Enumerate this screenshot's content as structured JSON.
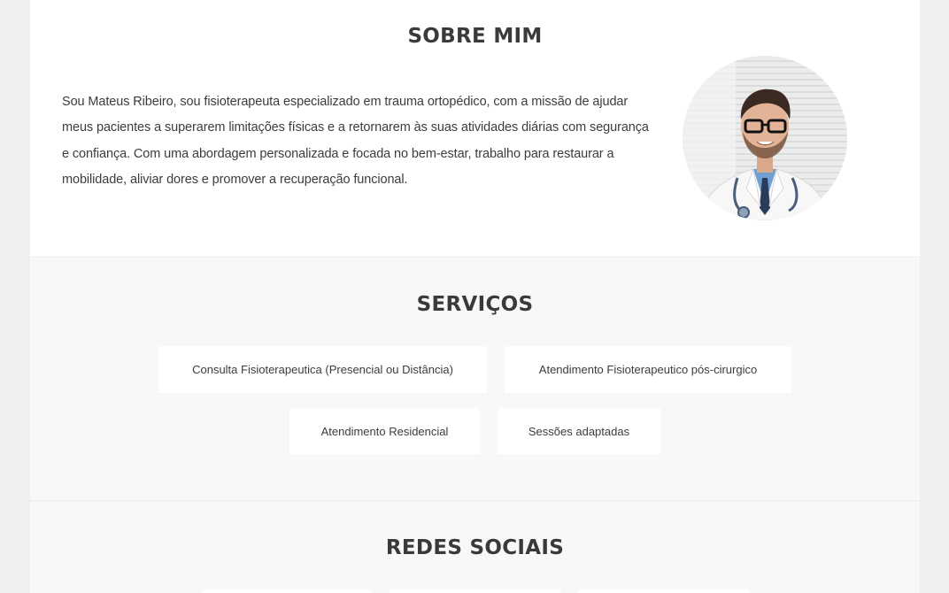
{
  "about": {
    "title": "SOBRE MIM",
    "text": "Sou Mateus Ribeiro, sou fisioterapeuta especializado em trauma ortopédico, com a missão de ajudar meus pacientes a superarem limitações físicas e a retornarem às suas atividades diárias com segurança e confiança. Com uma abordagem personalizada e focada no bem-estar, trabalho para restaurar a mobilidade, aliviar dores e promover a recuperação funcional."
  },
  "services": {
    "title": "SERVIÇOS",
    "items": [
      "Consulta Fisioterapeutica (Presencial ou Distância)",
      "Atendimento Fisioterapeutico pós-cirurgico",
      "Atendimento Residencial",
      "Sessões adaptadas"
    ]
  },
  "social": {
    "title": "REDES SOCIAIS"
  },
  "colors": {
    "page_bg": "#efefef",
    "section_alt_bg": "#f8f8f8",
    "heading": "#3a3a3a",
    "body_text": "#3c3c3c"
  }
}
